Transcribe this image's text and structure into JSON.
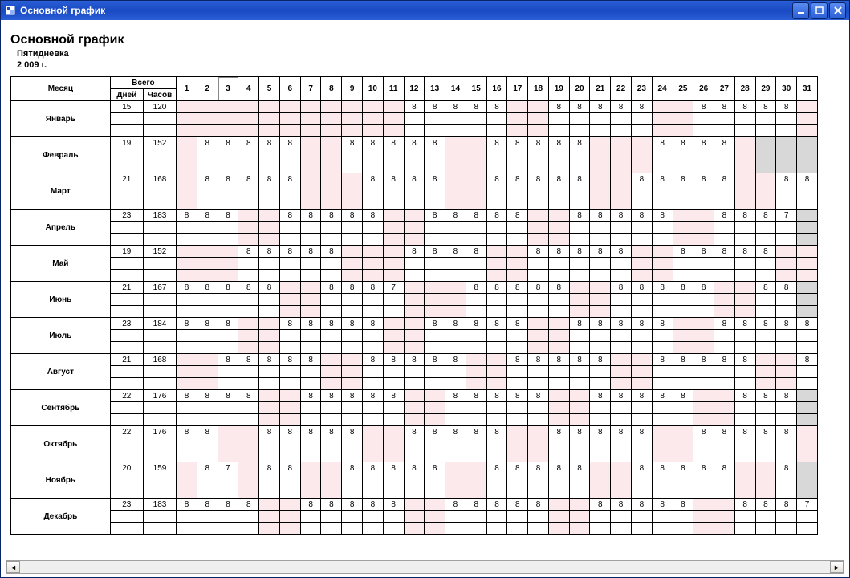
{
  "window": {
    "title": "Основной график"
  },
  "report": {
    "title": "Основной график",
    "subtitle": "Пятидневка",
    "year": "2 009 г."
  },
  "headers": {
    "month": "Месяц",
    "total": "Всего",
    "days": "Дней",
    "hours": "Часов",
    "dayNumbers": [
      "1",
      "2",
      "3",
      "4",
      "5",
      "6",
      "7",
      "8",
      "9",
      "10",
      "11",
      "12",
      "13",
      "14",
      "15",
      "16",
      "17",
      "18",
      "19",
      "20",
      "21",
      "22",
      "23",
      "24",
      "25",
      "26",
      "27",
      "28",
      "29",
      "30",
      "31"
    ]
  },
  "selectedDayColumn": "3",
  "months": [
    {
      "name": "Январь",
      "days": "15",
      "hours": "120",
      "cells": [
        {
          "v": "",
          "c": "wk"
        },
        {
          "v": "",
          "c": "wk"
        },
        {
          "v": "",
          "c": "wk"
        },
        {
          "v": "",
          "c": "wk"
        },
        {
          "v": "",
          "c": "wk"
        },
        {
          "v": "",
          "c": "wk"
        },
        {
          "v": "",
          "c": "wk"
        },
        {
          "v": "",
          "c": "wk"
        },
        {
          "v": "",
          "c": "wk"
        },
        {
          "v": "",
          "c": "wk"
        },
        {
          "v": "",
          "c": "wk"
        },
        {
          "v": "8"
        },
        {
          "v": "8"
        },
        {
          "v": "8"
        },
        {
          "v": "8"
        },
        {
          "v": "8"
        },
        {
          "v": "",
          "c": "wk"
        },
        {
          "v": "",
          "c": "wk"
        },
        {
          "v": "8"
        },
        {
          "v": "8"
        },
        {
          "v": "8"
        },
        {
          "v": "8"
        },
        {
          "v": "8"
        },
        {
          "v": "",
          "c": "wk"
        },
        {
          "v": "",
          "c": "wk"
        },
        {
          "v": "8"
        },
        {
          "v": "8"
        },
        {
          "v": "8"
        },
        {
          "v": "8"
        },
        {
          "v": "8"
        },
        {
          "v": "",
          "c": "wk"
        }
      ]
    },
    {
      "name": "Февраль",
      "days": "19",
      "hours": "152",
      "cells": [
        {
          "v": "",
          "c": "wk"
        },
        {
          "v": "8"
        },
        {
          "v": "8"
        },
        {
          "v": "8"
        },
        {
          "v": "8"
        },
        {
          "v": "8"
        },
        {
          "v": "",
          "c": "wk"
        },
        {
          "v": "",
          "c": "wk"
        },
        {
          "v": "8"
        },
        {
          "v": "8"
        },
        {
          "v": "8"
        },
        {
          "v": "8"
        },
        {
          "v": "8"
        },
        {
          "v": "",
          "c": "wk"
        },
        {
          "v": "",
          "c": "wk"
        },
        {
          "v": "8"
        },
        {
          "v": "8"
        },
        {
          "v": "8"
        },
        {
          "v": "8"
        },
        {
          "v": "8"
        },
        {
          "v": "",
          "c": "wk"
        },
        {
          "v": "",
          "c": "wk"
        },
        {
          "v": "",
          "c": "wk"
        },
        {
          "v": "8"
        },
        {
          "v": "8"
        },
        {
          "v": "8"
        },
        {
          "v": "8"
        },
        {
          "v": "",
          "c": "wk"
        },
        {
          "v": "",
          "c": "na"
        },
        {
          "v": "",
          "c": "na"
        },
        {
          "v": "",
          "c": "na"
        }
      ]
    },
    {
      "name": "Март",
      "days": "21",
      "hours": "168",
      "cells": [
        {
          "v": "",
          "c": "wk"
        },
        {
          "v": "8"
        },
        {
          "v": "8"
        },
        {
          "v": "8"
        },
        {
          "v": "8"
        },
        {
          "v": "8"
        },
        {
          "v": "",
          "c": "wk"
        },
        {
          "v": "",
          "c": "wk"
        },
        {
          "v": "",
          "c": "wk"
        },
        {
          "v": "8"
        },
        {
          "v": "8"
        },
        {
          "v": "8"
        },
        {
          "v": "8"
        },
        {
          "v": "",
          "c": "wk"
        },
        {
          "v": "",
          "c": "wk"
        },
        {
          "v": "8"
        },
        {
          "v": "8"
        },
        {
          "v": "8"
        },
        {
          "v": "8"
        },
        {
          "v": "8"
        },
        {
          "v": "",
          "c": "wk"
        },
        {
          "v": "",
          "c": "wk"
        },
        {
          "v": "8"
        },
        {
          "v": "8"
        },
        {
          "v": "8"
        },
        {
          "v": "8"
        },
        {
          "v": "8"
        },
        {
          "v": "",
          "c": "wk"
        },
        {
          "v": "",
          "c": "wk"
        },
        {
          "v": "8"
        },
        {
          "v": "8"
        }
      ]
    },
    {
      "name": "Апрель",
      "days": "23",
      "hours": "183",
      "cells": [
        {
          "v": "8"
        },
        {
          "v": "8"
        },
        {
          "v": "8"
        },
        {
          "v": "",
          "c": "wk"
        },
        {
          "v": "",
          "c": "wk"
        },
        {
          "v": "8"
        },
        {
          "v": "8"
        },
        {
          "v": "8"
        },
        {
          "v": "8"
        },
        {
          "v": "8"
        },
        {
          "v": "",
          "c": "wk"
        },
        {
          "v": "",
          "c": "wk"
        },
        {
          "v": "8"
        },
        {
          "v": "8"
        },
        {
          "v": "8"
        },
        {
          "v": "8"
        },
        {
          "v": "8"
        },
        {
          "v": "",
          "c": "wk"
        },
        {
          "v": "",
          "c": "wk"
        },
        {
          "v": "8"
        },
        {
          "v": "8"
        },
        {
          "v": "8"
        },
        {
          "v": "8"
        },
        {
          "v": "8"
        },
        {
          "v": "",
          "c": "wk"
        },
        {
          "v": "",
          "c": "wk"
        },
        {
          "v": "8"
        },
        {
          "v": "8"
        },
        {
          "v": "8"
        },
        {
          "v": "7"
        },
        {
          "v": "",
          "c": "na"
        }
      ]
    },
    {
      "name": "Май",
      "days": "19",
      "hours": "152",
      "cells": [
        {
          "v": "",
          "c": "wk"
        },
        {
          "v": "",
          "c": "wk"
        },
        {
          "v": "",
          "c": "wk"
        },
        {
          "v": "8"
        },
        {
          "v": "8"
        },
        {
          "v": "8"
        },
        {
          "v": "8"
        },
        {
          "v": "8"
        },
        {
          "v": "",
          "c": "wk"
        },
        {
          "v": "",
          "c": "wk"
        },
        {
          "v": "",
          "c": "wk"
        },
        {
          "v": "8"
        },
        {
          "v": "8"
        },
        {
          "v": "8"
        },
        {
          "v": "8"
        },
        {
          "v": "",
          "c": "wk"
        },
        {
          "v": "",
          "c": "wk"
        },
        {
          "v": "8"
        },
        {
          "v": "8"
        },
        {
          "v": "8"
        },
        {
          "v": "8"
        },
        {
          "v": "8"
        },
        {
          "v": "",
          "c": "wk"
        },
        {
          "v": "",
          "c": "wk"
        },
        {
          "v": "8"
        },
        {
          "v": "8"
        },
        {
          "v": "8"
        },
        {
          "v": "8"
        },
        {
          "v": "8"
        },
        {
          "v": "",
          "c": "wk"
        },
        {
          "v": "",
          "c": "wk"
        }
      ]
    },
    {
      "name": "Июнь",
      "days": "21",
      "hours": "167",
      "cells": [
        {
          "v": "8"
        },
        {
          "v": "8"
        },
        {
          "v": "8"
        },
        {
          "v": "8"
        },
        {
          "v": "8"
        },
        {
          "v": "",
          "c": "wk"
        },
        {
          "v": "",
          "c": "wk"
        },
        {
          "v": "8"
        },
        {
          "v": "8"
        },
        {
          "v": "8"
        },
        {
          "v": "7"
        },
        {
          "v": "",
          "c": "wk"
        },
        {
          "v": "",
          "c": "wk"
        },
        {
          "v": "",
          "c": "wk"
        },
        {
          "v": "8"
        },
        {
          "v": "8"
        },
        {
          "v": "8"
        },
        {
          "v": "8"
        },
        {
          "v": "8"
        },
        {
          "v": "",
          "c": "wk"
        },
        {
          "v": "",
          "c": "wk"
        },
        {
          "v": "8"
        },
        {
          "v": "8"
        },
        {
          "v": "8"
        },
        {
          "v": "8"
        },
        {
          "v": "8"
        },
        {
          "v": "",
          "c": "wk"
        },
        {
          "v": "",
          "c": "wk"
        },
        {
          "v": "8"
        },
        {
          "v": "8"
        },
        {
          "v": "",
          "c": "na"
        }
      ]
    },
    {
      "name": "Июль",
      "days": "23",
      "hours": "184",
      "cells": [
        {
          "v": "8"
        },
        {
          "v": "8"
        },
        {
          "v": "8"
        },
        {
          "v": "",
          "c": "wk"
        },
        {
          "v": "",
          "c": "wk"
        },
        {
          "v": "8"
        },
        {
          "v": "8"
        },
        {
          "v": "8"
        },
        {
          "v": "8"
        },
        {
          "v": "8"
        },
        {
          "v": "",
          "c": "wk"
        },
        {
          "v": "",
          "c": "wk"
        },
        {
          "v": "8"
        },
        {
          "v": "8"
        },
        {
          "v": "8"
        },
        {
          "v": "8"
        },
        {
          "v": "8"
        },
        {
          "v": "",
          "c": "wk"
        },
        {
          "v": "",
          "c": "wk"
        },
        {
          "v": "8"
        },
        {
          "v": "8"
        },
        {
          "v": "8"
        },
        {
          "v": "8"
        },
        {
          "v": "8"
        },
        {
          "v": "",
          "c": "wk"
        },
        {
          "v": "",
          "c": "wk"
        },
        {
          "v": "8"
        },
        {
          "v": "8"
        },
        {
          "v": "8"
        },
        {
          "v": "8"
        },
        {
          "v": "8"
        }
      ]
    },
    {
      "name": "Август",
      "days": "21",
      "hours": "168",
      "cells": [
        {
          "v": "",
          "c": "wk"
        },
        {
          "v": "",
          "c": "wk"
        },
        {
          "v": "8"
        },
        {
          "v": "8"
        },
        {
          "v": "8"
        },
        {
          "v": "8"
        },
        {
          "v": "8"
        },
        {
          "v": "",
          "c": "wk"
        },
        {
          "v": "",
          "c": "wk"
        },
        {
          "v": "8"
        },
        {
          "v": "8"
        },
        {
          "v": "8"
        },
        {
          "v": "8"
        },
        {
          "v": "8"
        },
        {
          "v": "",
          "c": "wk"
        },
        {
          "v": "",
          "c": "wk"
        },
        {
          "v": "8"
        },
        {
          "v": "8"
        },
        {
          "v": "8"
        },
        {
          "v": "8"
        },
        {
          "v": "8"
        },
        {
          "v": "",
          "c": "wk"
        },
        {
          "v": "",
          "c": "wk"
        },
        {
          "v": "8"
        },
        {
          "v": "8"
        },
        {
          "v": "8"
        },
        {
          "v": "8"
        },
        {
          "v": "8"
        },
        {
          "v": "",
          "c": "wk"
        },
        {
          "v": "",
          "c": "wk"
        },
        {
          "v": "8"
        }
      ]
    },
    {
      "name": "Сентябрь",
      "days": "22",
      "hours": "176",
      "cells": [
        {
          "v": "8"
        },
        {
          "v": "8"
        },
        {
          "v": "8"
        },
        {
          "v": "8"
        },
        {
          "v": "",
          "c": "wk"
        },
        {
          "v": "",
          "c": "wk"
        },
        {
          "v": "8"
        },
        {
          "v": "8"
        },
        {
          "v": "8"
        },
        {
          "v": "8"
        },
        {
          "v": "8"
        },
        {
          "v": "",
          "c": "wk"
        },
        {
          "v": "",
          "c": "wk"
        },
        {
          "v": "8"
        },
        {
          "v": "8"
        },
        {
          "v": "8"
        },
        {
          "v": "8"
        },
        {
          "v": "8"
        },
        {
          "v": "",
          "c": "wk"
        },
        {
          "v": "",
          "c": "wk"
        },
        {
          "v": "8"
        },
        {
          "v": "8"
        },
        {
          "v": "8"
        },
        {
          "v": "8"
        },
        {
          "v": "8"
        },
        {
          "v": "",
          "c": "wk"
        },
        {
          "v": "",
          "c": "wk"
        },
        {
          "v": "8"
        },
        {
          "v": "8"
        },
        {
          "v": "8"
        },
        {
          "v": "",
          "c": "na"
        }
      ]
    },
    {
      "name": "Октябрь",
      "days": "22",
      "hours": "176",
      "cells": [
        {
          "v": "8"
        },
        {
          "v": "8"
        },
        {
          "v": "",
          "c": "wk"
        },
        {
          "v": "",
          "c": "wk"
        },
        {
          "v": "8"
        },
        {
          "v": "8"
        },
        {
          "v": "8"
        },
        {
          "v": "8"
        },
        {
          "v": "8"
        },
        {
          "v": "",
          "c": "wk"
        },
        {
          "v": "",
          "c": "wk"
        },
        {
          "v": "8"
        },
        {
          "v": "8"
        },
        {
          "v": "8"
        },
        {
          "v": "8"
        },
        {
          "v": "8"
        },
        {
          "v": "",
          "c": "wk"
        },
        {
          "v": "",
          "c": "wk"
        },
        {
          "v": "8"
        },
        {
          "v": "8"
        },
        {
          "v": "8"
        },
        {
          "v": "8"
        },
        {
          "v": "8"
        },
        {
          "v": "",
          "c": "wk"
        },
        {
          "v": "",
          "c": "wk"
        },
        {
          "v": "8"
        },
        {
          "v": "8"
        },
        {
          "v": "8"
        },
        {
          "v": "8"
        },
        {
          "v": "8"
        },
        {
          "v": "",
          "c": "wk"
        }
      ]
    },
    {
      "name": "Ноябрь",
      "days": "20",
      "hours": "159",
      "cells": [
        {
          "v": "",
          "c": "wk"
        },
        {
          "v": "8"
        },
        {
          "v": "7"
        },
        {
          "v": "",
          "c": "wk"
        },
        {
          "v": "8"
        },
        {
          "v": "8"
        },
        {
          "v": "",
          "c": "wk"
        },
        {
          "v": "",
          "c": "wk"
        },
        {
          "v": "8"
        },
        {
          "v": "8"
        },
        {
          "v": "8"
        },
        {
          "v": "8"
        },
        {
          "v": "8"
        },
        {
          "v": "",
          "c": "wk"
        },
        {
          "v": "",
          "c": "wk"
        },
        {
          "v": "8"
        },
        {
          "v": "8"
        },
        {
          "v": "8"
        },
        {
          "v": "8"
        },
        {
          "v": "8"
        },
        {
          "v": "",
          "c": "wk"
        },
        {
          "v": "",
          "c": "wk"
        },
        {
          "v": "8"
        },
        {
          "v": "8"
        },
        {
          "v": "8"
        },
        {
          "v": "8"
        },
        {
          "v": "8"
        },
        {
          "v": "",
          "c": "wk"
        },
        {
          "v": "",
          "c": "wk"
        },
        {
          "v": "8"
        },
        {
          "v": "",
          "c": "na"
        }
      ]
    },
    {
      "name": "Декабрь",
      "days": "23",
      "hours": "183",
      "cells": [
        {
          "v": "8"
        },
        {
          "v": "8"
        },
        {
          "v": "8"
        },
        {
          "v": "8"
        },
        {
          "v": "",
          "c": "wk"
        },
        {
          "v": "",
          "c": "wk"
        },
        {
          "v": "8"
        },
        {
          "v": "8"
        },
        {
          "v": "8"
        },
        {
          "v": "8"
        },
        {
          "v": "8"
        },
        {
          "v": "",
          "c": "wk"
        },
        {
          "v": "",
          "c": "wk"
        },
        {
          "v": "8"
        },
        {
          "v": "8"
        },
        {
          "v": "8"
        },
        {
          "v": "8"
        },
        {
          "v": "8"
        },
        {
          "v": "",
          "c": "wk"
        },
        {
          "v": "",
          "c": "wk"
        },
        {
          "v": "8"
        },
        {
          "v": "8"
        },
        {
          "v": "8"
        },
        {
          "v": "8"
        },
        {
          "v": "8"
        },
        {
          "v": "",
          "c": "wk"
        },
        {
          "v": "",
          "c": "wk"
        },
        {
          "v": "8"
        },
        {
          "v": "8"
        },
        {
          "v": "8"
        },
        {
          "v": "7"
        }
      ]
    }
  ]
}
